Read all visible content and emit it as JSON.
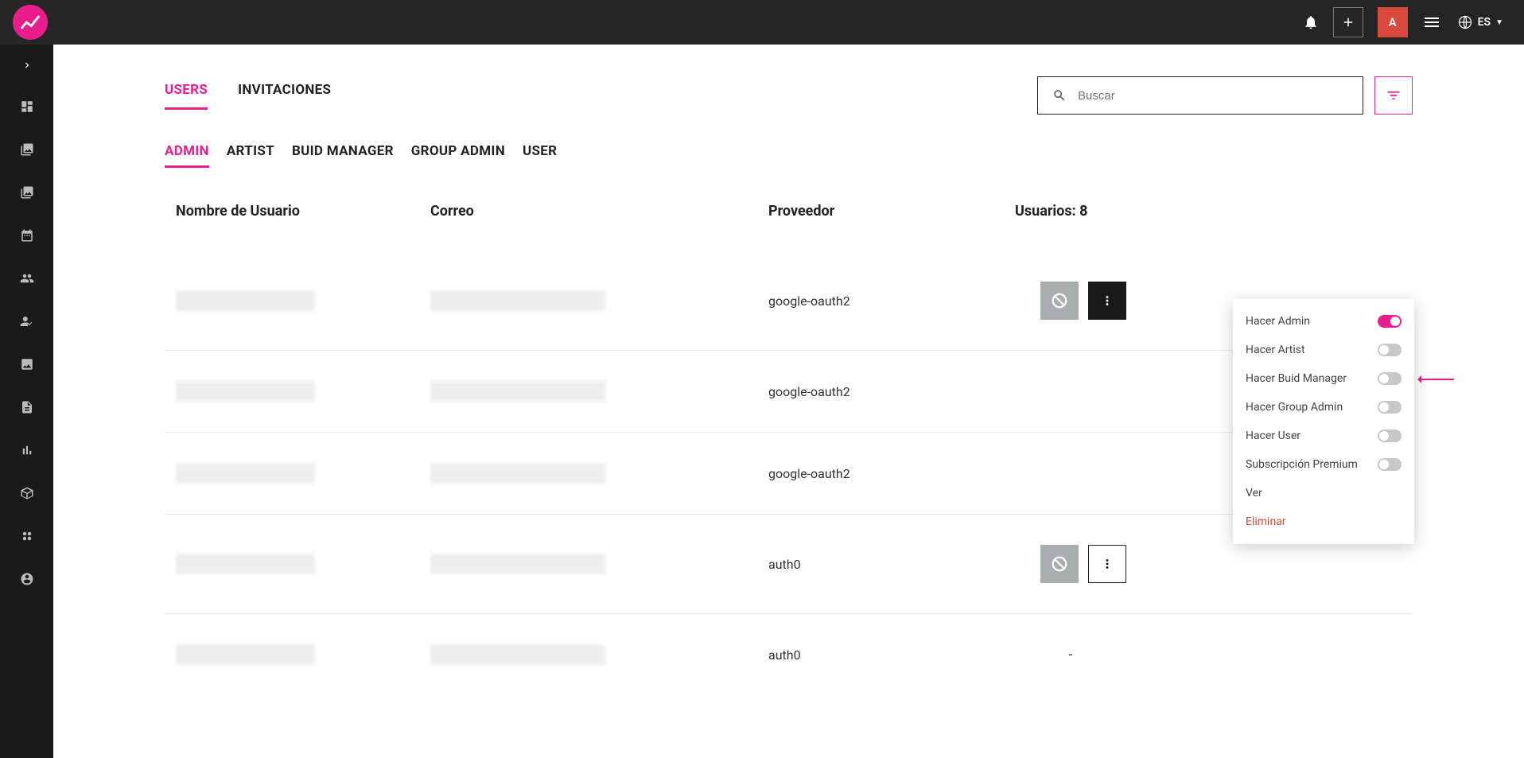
{
  "topbar": {
    "avatar_letter": "A",
    "language": "ES"
  },
  "tabs": {
    "users": "USERS",
    "invitations": "INVITACIONES"
  },
  "search": {
    "placeholder": "Buscar"
  },
  "subtabs": {
    "admin": "ADMIN",
    "artist": "ARTIST",
    "buid_manager": "BUID MANAGER",
    "group_admin": "GROUP ADMIN",
    "user": "USER"
  },
  "table": {
    "header_username": "Nombre de Usuario",
    "header_email": "Correo",
    "header_provider": "Proveedor",
    "header_count": "Usuarios: 8"
  },
  "rows": [
    {
      "provider": "google-oauth2",
      "menu_open": true
    },
    {
      "provider": "google-oauth2"
    },
    {
      "provider": "google-oauth2"
    },
    {
      "provider": "auth0"
    },
    {
      "provider": "auth0"
    }
  ],
  "dropdown": {
    "make_admin": "Hacer Admin",
    "make_artist": "Hacer Artist",
    "make_buid_manager": "Hacer Buid Manager",
    "make_group_admin": "Hacer Group Admin",
    "make_user": "Hacer User",
    "premium": "Subscripción Premium",
    "view": "Ver",
    "delete": "Eliminar",
    "admin_on": true
  }
}
